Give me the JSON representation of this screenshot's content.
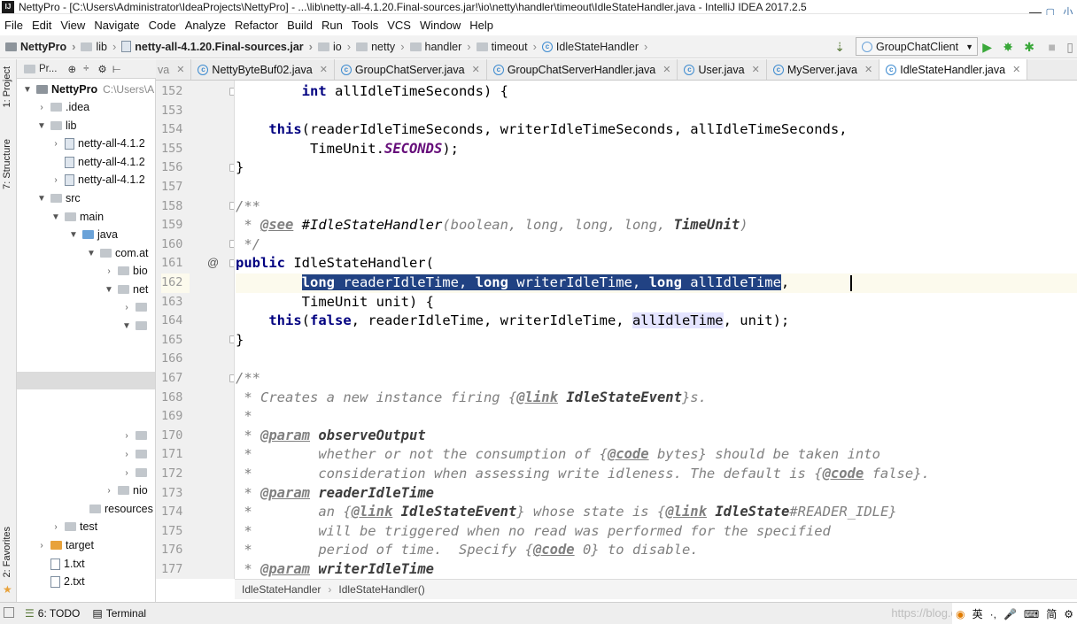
{
  "window": {
    "title": "NettyPro - [C:\\Users\\Administrator\\IdeaProjects\\NettyPro] - ...\\lib\\netty-all-4.1.20.Final-sources.jar!\\io\\netty\\handler\\timeout\\IdleStateHandler.java - IntelliJ IDEA 2017.2.5",
    "ext_label": "小"
  },
  "menu": [
    "File",
    "Edit",
    "View",
    "Navigate",
    "Code",
    "Analyze",
    "Refactor",
    "Build",
    "Run",
    "Tools",
    "VCS",
    "Window",
    "Help"
  ],
  "breadcrumb": [
    "NettyPro",
    "lib",
    "netty-all-4.1.20.Final-sources.jar",
    "io",
    "netty",
    "handler",
    "timeout",
    "IdleStateHandler"
  ],
  "run_config": "GroupChatClient",
  "left_tabs": {
    "project": "1: Project",
    "structure": "7: Structure",
    "favorites": "2: Favorites"
  },
  "project_header": {
    "label": "Pr..."
  },
  "tree": [
    {
      "label": "NettyPro",
      "hint": "C:\\Users\\A",
      "bold": true
    },
    {
      "label": ".idea"
    },
    {
      "label": "lib"
    },
    {
      "label": "netty-all-4.1.2"
    },
    {
      "label": "netty-all-4.1.2"
    },
    {
      "label": "netty-all-4.1.2"
    },
    {
      "label": "src"
    },
    {
      "label": "main"
    },
    {
      "label": "java"
    },
    {
      "label": "com.at"
    },
    {
      "label": "bio"
    },
    {
      "label": "net"
    },
    {
      "label": ""
    },
    {
      "label": ""
    },
    {
      "label": ""
    },
    {
      "label": ""
    },
    {
      "label": ""
    },
    {
      "label": ""
    },
    {
      "label": "nio"
    },
    {
      "label": "resources"
    },
    {
      "label": "test"
    },
    {
      "label": "target"
    },
    {
      "label": "1.txt"
    },
    {
      "label": "2.txt"
    }
  ],
  "tabs": [
    {
      "label": "va",
      "partial": true
    },
    {
      "label": "NettyByteBuf02.java"
    },
    {
      "label": "GroupChatServer.java"
    },
    {
      "label": "GroupChatServerHandler.java"
    },
    {
      "label": "User.java"
    },
    {
      "label": "MyServer.java"
    },
    {
      "label": "IdleStateHandler.java",
      "active": true
    }
  ],
  "code": {
    "line_numbers": [
      "152",
      "153",
      "154",
      "155",
      "156",
      "157",
      "158",
      "159",
      "160",
      "161",
      "162",
      "163",
      "164",
      "165",
      "166",
      "167",
      "168",
      "169",
      "170",
      "171",
      "172",
      "173",
      "174",
      "175",
      "176",
      "177"
    ],
    "lines": [
      "        int allIdleTimeSeconds) {",
      "",
      "    this(readerIdleTimeSeconds, writerIdleTimeSeconds, allIdleTimeSeconds,",
      "         TimeUnit.SECONDS);",
      "}",
      "",
      "/**",
      " * @see #IdleStateHandler(boolean, long, long, long, TimeUnit)",
      " */",
      "public IdleStateHandler(",
      "        long readerIdleTime, long writerIdleTime, long allIdleTime,",
      "        TimeUnit unit) {",
      "    this(false, readerIdleTime, writerIdleTime, allIdleTime, unit);",
      "}",
      "",
      "/**",
      " * Creates a new instance firing {@link IdleStateEvent}s.",
      " *",
      " * @param observeOutput",
      " *        whether or not the consumption of {@code bytes} should be taken into",
      " *        consideration when assessing write idleness. The default is {@code false}.",
      " * @param readerIdleTime",
      " *        an {@link IdleStateEvent} whose state is {@link IdleState#READER_IDLE}",
      " *        will be triggered when no read was performed for the specified",
      " *        period of time.  Specify {@code 0} to disable.",
      " * @param writerIdleTime"
    ]
  },
  "editor_breadcrumb": [
    "IdleStateHandler",
    "IdleStateHandler()"
  ],
  "bottom": {
    "todo": "6: TODO",
    "terminal": "Terminal"
  },
  "watermark": "https://blog.csdn",
  "ime": [
    "英",
    "·,",
    "简",
    "⚙"
  ]
}
